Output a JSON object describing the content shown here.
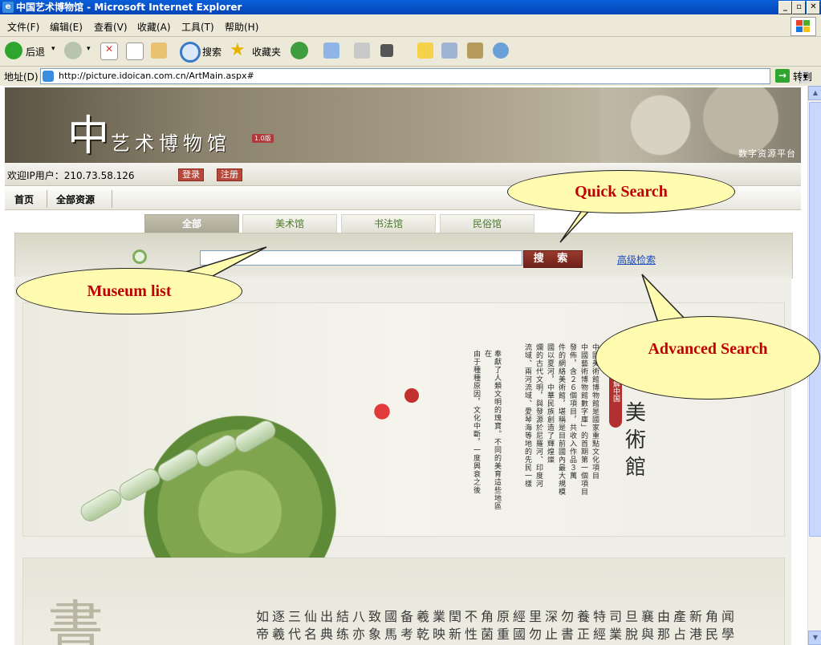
{
  "window": {
    "title": "中国艺术博物馆 - Microsoft Internet Explorer"
  },
  "menu": [
    "文件(F)",
    "编辑(E)",
    "查看(V)",
    "收藏(A)",
    "工具(T)",
    "帮助(H)"
  ],
  "toolbar": {
    "back": "后退",
    "search": "搜索",
    "favorites": "收藏夹"
  },
  "address": {
    "label": "地址(D)",
    "url": "http://picture.idoican.com.cn/ArtMain.aspx#",
    "go": "转到"
  },
  "banner": {
    "logo_char": "中",
    "logo_text": "艺术博物馆",
    "badge": "1.0版",
    "platform": "数字资源平台"
  },
  "welcome": {
    "text": "欢迎IP用户：210.73.58.126",
    "login": "登录",
    "register": "注册"
  },
  "nav": [
    "首页",
    "全部资源"
  ],
  "tabs": [
    {
      "label": "全部",
      "active": true
    },
    {
      "label": "美术馆",
      "active": false
    },
    {
      "label": "书法馆",
      "active": false
    },
    {
      "label": "民俗馆",
      "active": false
    }
  ],
  "search": {
    "button": "搜 索",
    "advanced": "高级检索",
    "value": ""
  },
  "artwork": {
    "seal": "了解中国",
    "title_chars": [
      "美",
      "術",
      "館"
    ],
    "columns": [
      "中國美術館博物館是國家重點文化項目",
      "中國藝術博物館數字庫」的首期第一個項目",
      "發佈，含２６個項目，共收入作品３萬",
      "件的網絡美術館，堪稱是目前國內最大規模",
      "國以夏河，中華民族創造了輝煌燦",
      "爛的古代文明，與發源於尼羅河、印度河",
      "流域、兩河流域、愛琴海等地的先民一樣",
      "奉獻了人類文明的瑰寶。不同的美育這些地區在",
      "由于種種原因，文化中斷，一度興衰之後"
    ]
  },
  "artwork2": {
    "big_char": "書",
    "row1": "如逐三仙出結八致國备羲業閏不角原經里深勿養特司旦襄由產新角闻",
    "row2": "帝羲代名典练亦象馬考乾映新性菌重國勿止書正經業脫與那占港民學"
  },
  "callouts": {
    "quick_search": "Quick Search",
    "museum_list": "Museum list",
    "advanced_search": "Advanced Search"
  }
}
